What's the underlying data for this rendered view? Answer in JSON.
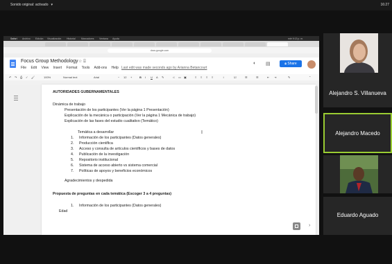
{
  "top": {
    "sound_label": "Sonido original: activado",
    "clock": "16:27"
  },
  "mac_menu": [
    "Safari",
    "Archivo",
    "Edición",
    "Visualización",
    "Historial",
    "Marcadores",
    "Ventana",
    "Ayuda"
  ],
  "mac_status": "mié 9:13 p. m.",
  "url": "docs.google.com",
  "doc": {
    "title": "Focus Group Methodology",
    "menus": [
      "File",
      "Edit",
      "View",
      "Insert",
      "Format",
      "Tools",
      "Add-ons",
      "Help"
    ],
    "last_edit": "Last edit was made seconds ago by Arianna Betancourt",
    "share_label": "Share",
    "toolbar": {
      "zoom": "100%",
      "style": "Normal text",
      "font": "Arial",
      "size": "12"
    },
    "lines": {
      "heading": "AUTORIDADES GUBERNAMENTALES",
      "plan": "Dinámica de trabajo",
      "p1": "Presentación de los participantes (Ver la página 1 Presentación)",
      "p2": "Explicación de la mecánica o participación (Ver la página 1 Mecánica de trabajo)",
      "p3": "Explicación de las fases del estudio cualitativo (Temático)",
      "tematica": "Temática a desarrollar",
      "items": [
        "Información de los participantes (Datos generales)",
        "Producción científica",
        "Acceso y consulta de artículos científicos y bases de datos",
        "Publicación de la investigación",
        "Repositorio institucional",
        "Sistema de acceso abierto vs sistema comercial",
        "Políticas de apoyos y beneficios económicos"
      ],
      "agradecimientos": "Agradecimientos y despedida",
      "propuesta": "Propuesta de preguntas en cada temática (Escoger 3 a 4 preguntas)",
      "info": "Información de los participantes (Datos generales)",
      "edad": "Edad"
    }
  },
  "participants": [
    {
      "name": "Alejandro S. Villanueva"
    },
    {
      "name": "Alejandro Macedo"
    },
    {
      "name": "Eduardo Aguado"
    }
  ],
  "colors": {
    "active_speaker": "#9acd32",
    "share_blue": "#1a73e8"
  }
}
